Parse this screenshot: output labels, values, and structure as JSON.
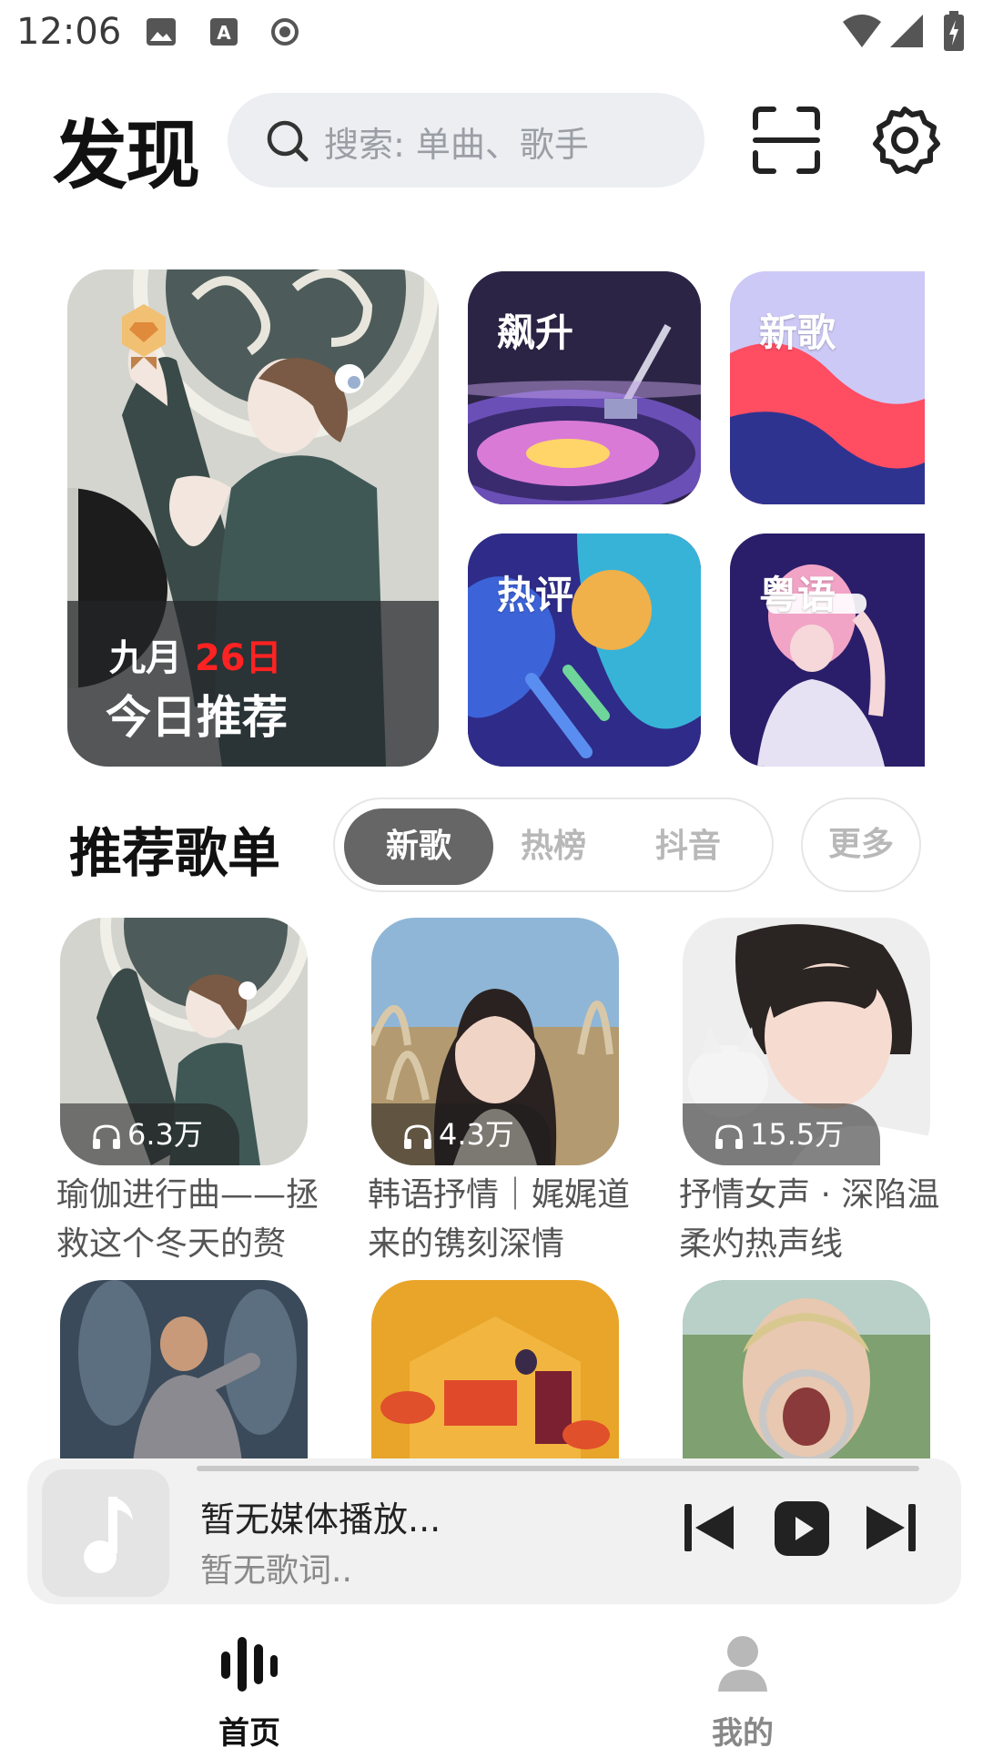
{
  "status_bar": {
    "time": "12:06"
  },
  "header": {
    "title": "发现",
    "search_placeholder": "搜索: 单曲、歌手"
  },
  "daily": {
    "month": "九月",
    "day": "26日",
    "title": "今日推荐"
  },
  "tiles": {
    "rising": "飙升",
    "new_songs": "新歌",
    "hot_comments": "热评",
    "cantonese": "粤语"
  },
  "playlist_section": {
    "title": "推荐歌单",
    "tabs": [
      "新歌",
      "热榜",
      "抖音"
    ],
    "active_tab": "新歌",
    "more": "更多"
  },
  "playlists": [
    {
      "plays": "6.3万",
      "title": "瑜伽进行曲——拯救这个冬天的赘"
    },
    {
      "plays": "4.3万",
      "title": "韩语抒情｜娓娓道来的镌刻深情"
    },
    {
      "plays": "15.5万",
      "title": "抒情女声 · 深陷温柔灼热声线"
    }
  ],
  "player": {
    "title": "暂无媒体播放...",
    "lyric": "暂无歌词.."
  },
  "nav": {
    "home": "首页",
    "mine": "我的"
  },
  "colors": {
    "accent_red": "#ff2222",
    "active_tab_bg": "#666666",
    "search_bg": "#eceef1"
  }
}
